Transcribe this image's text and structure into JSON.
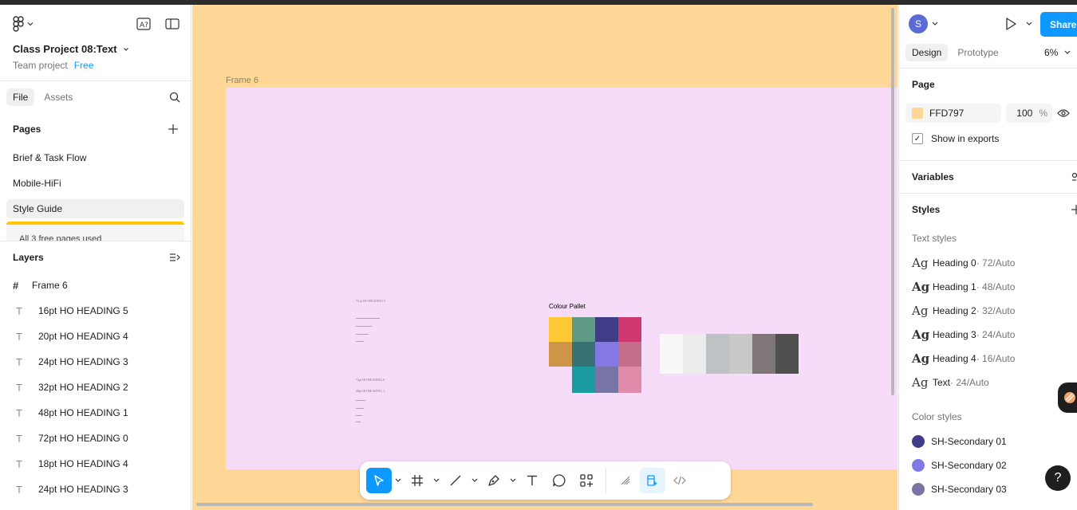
{
  "file": {
    "title": "Class Project 08:Text",
    "team": "Team project",
    "plan": "Free"
  },
  "left_tabs": [
    "File",
    "Assets"
  ],
  "pages": {
    "heading": "Pages",
    "items": [
      "Brief & Task Flow",
      "Mobile-HiFi",
      "Style Guide"
    ],
    "banner": "All 3 free pages used"
  },
  "layers": {
    "heading": "Layers",
    "frame": "Frame 6",
    "items": [
      "16pt HO HEADING 5",
      "20pt HO HEADING 4",
      "24pt HO HEADING 3",
      "32pt HO HEADING 2",
      "48pt HO HEADING 1",
      "72pt HO HEADING 0",
      "18pt HO HEADING 4",
      "24pt HO HEADING 3"
    ]
  },
  "canvas": {
    "frame_label": "Frame 6",
    "bg_color": "#FFD797",
    "frame_color": "#F6DCF8",
    "pallet_title": "Colour Pallet",
    "swatch_colors": {
      "row1": [
        "#FDC936",
        "#5F9A85",
        "#413C88",
        "#CE386E"
      ],
      "row2": [
        "#CC9548",
        "#367276",
        "#8479E4",
        "#C36E8B"
      ],
      "row3": [
        "#1A9BA0",
        "#7874A6",
        "#E08BAA"
      ],
      "neutrals": [
        "#F8F8F8",
        "#ECECEC",
        "#BFC2C5",
        "#C8C8C8",
        "#7F7777",
        "#505050"
      ]
    }
  },
  "right": {
    "avatar_initial": "S",
    "share_label": "Share",
    "tabs": [
      "Design",
      "Prototype"
    ],
    "zoom": "6%",
    "page_section": "Page",
    "page_fill_hex": "FFD797",
    "page_fill_opacity": "100",
    "page_fill_unit": "%",
    "show_in_exports": "Show in exports",
    "variables": "Variables",
    "styles": "Styles",
    "text_styles_label": "Text styles",
    "text_styles": [
      {
        "name": "Heading 0",
        "meta": " · 72/Auto"
      },
      {
        "name": "Heading 1",
        "meta": " · 48/Auto"
      },
      {
        "name": "Heading 2",
        "meta": " · 32/Auto"
      },
      {
        "name": "Heading 3",
        "meta": " · 24/Auto"
      },
      {
        "name": "Heading 4",
        "meta": " · 16/Auto"
      },
      {
        "name": "Text",
        "meta": " · 24/Auto"
      }
    ],
    "color_styles_label": "Color styles",
    "color_styles": [
      {
        "name": "SH-Secondary 01",
        "color": "#413C88"
      },
      {
        "name": "SH-Secondary 02",
        "color": "#8479E4"
      },
      {
        "name": "SH-Secondary 03",
        "color": "#7874A6"
      }
    ]
  },
  "help_label": "?"
}
